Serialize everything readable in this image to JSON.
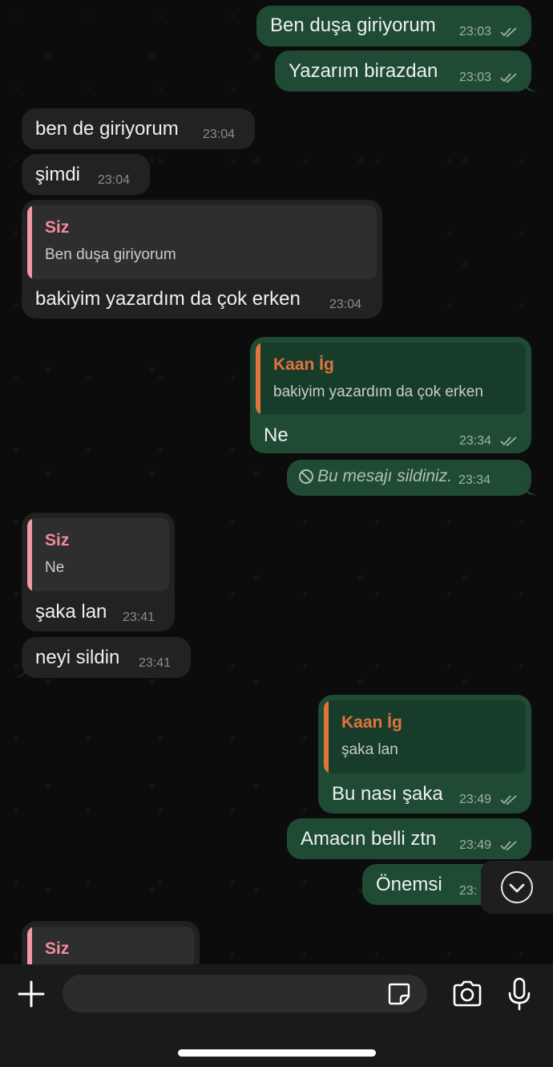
{
  "messages": [
    {
      "id": "m1",
      "direction": "out",
      "text": "Ben duşa giriyorum",
      "time": "23:03",
      "status": "read"
    },
    {
      "id": "m2",
      "direction": "out",
      "text": "Yazarım birazdan",
      "time": "23:03",
      "status": "read"
    },
    {
      "id": "m3",
      "direction": "in",
      "text": "ben de giriyorum",
      "time": "23:04"
    },
    {
      "id": "m4",
      "direction": "in",
      "text": "şimdi",
      "time": "23:04"
    },
    {
      "id": "m5",
      "direction": "in",
      "quote": {
        "name": "Siz",
        "text": "Ben duşa giriyorum"
      },
      "text": "bakiyim yazardım da çok erken",
      "time": "23:04"
    },
    {
      "id": "m6",
      "direction": "out",
      "quote": {
        "name": "Kaan İg",
        "text": "bakiyim yazardım da çok erken"
      },
      "text": "Ne",
      "time": "23:34",
      "status": "read"
    },
    {
      "id": "m7",
      "direction": "out",
      "deleted": true,
      "text": "Bu mesajı sildiniz.",
      "time": "23:34"
    },
    {
      "id": "m8",
      "direction": "in",
      "quote": {
        "name": "Siz",
        "text": "Ne"
      },
      "text": "şaka lan",
      "time": "23:41"
    },
    {
      "id": "m9",
      "direction": "in",
      "text": "neyi sildin",
      "time": "23:41"
    },
    {
      "id": "m10",
      "direction": "out",
      "quote": {
        "name": "Kaan İg",
        "text": "şaka lan"
      },
      "text": "Bu nası şaka",
      "time": "23:49",
      "status": "read"
    },
    {
      "id": "m11",
      "direction": "out",
      "text": "Amacın belli ztn",
      "time": "23:49",
      "status": "read"
    },
    {
      "id": "m12",
      "direction": "out",
      "text": "Önemsi",
      "time": "23:"
    },
    {
      "id": "m13",
      "direction": "in",
      "quote": {
        "name": "Siz"
      }
    }
  ],
  "composer": {
    "placeholder": "",
    "icons": [
      "plus-icon",
      "sticker-icon",
      "camera-icon",
      "microphone-icon"
    ]
  },
  "scroll_button": {
    "icon": "chevron-down-icon"
  },
  "colors": {
    "outgoing_bubble": "#1f4b34",
    "incoming_bubble": "#222222",
    "quote_self_name": "#f28b9e",
    "quote_self_bar": "#f09aa5",
    "quote_other_name": "#e0733e",
    "quote_other_bar": "#e0733e",
    "read_ticks": "#9fb0a6"
  }
}
